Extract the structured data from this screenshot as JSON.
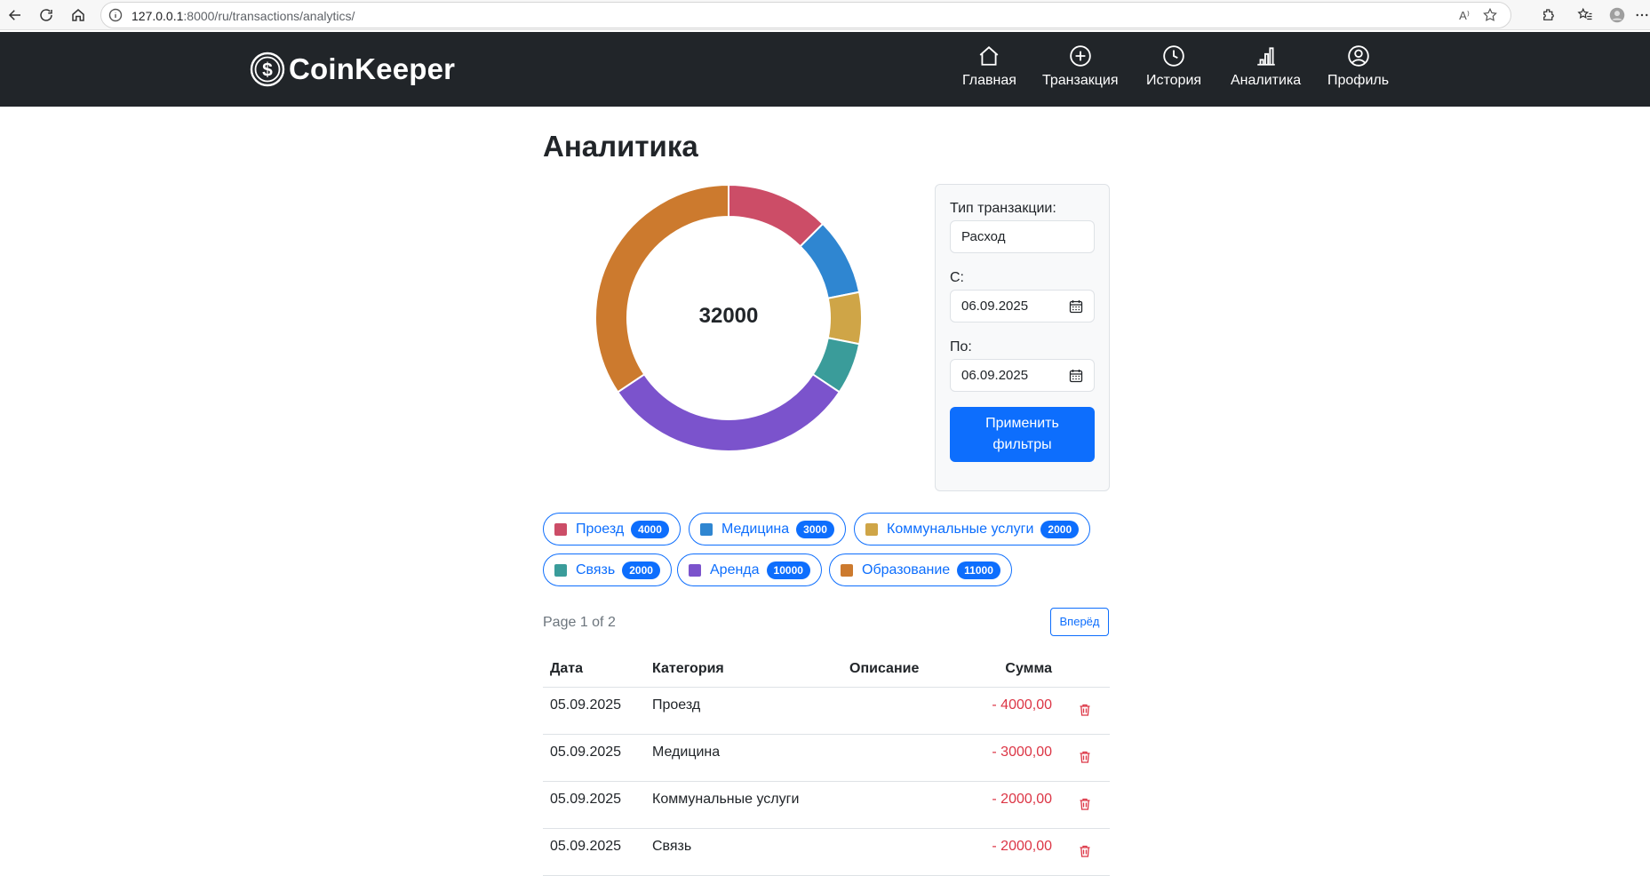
{
  "browser": {
    "url_host": "127.0.0.1",
    "url_rest": ":8000/ru/transactions/analytics/",
    "read_aloud": "A⁾"
  },
  "navbar": {
    "brand": "CoinKeeper",
    "items": [
      {
        "label": "Главная",
        "icon": "home-icon"
      },
      {
        "label": "Транзакция",
        "icon": "plus-circle-icon"
      },
      {
        "label": "История",
        "icon": "clock-icon"
      },
      {
        "label": "Аналитика",
        "icon": "bar-chart-icon"
      },
      {
        "label": "Профиль",
        "icon": "user-circle-icon"
      }
    ]
  },
  "page": {
    "title": "Аналитика",
    "total": "32000"
  },
  "chart_data": {
    "type": "pie",
    "categories": [
      "Проезд",
      "Медицина",
      "Коммунальные услуги",
      "Связь",
      "Аренда",
      "Образование"
    ],
    "values": [
      4000,
      3000,
      2000,
      2000,
      10000,
      11000
    ],
    "colors": [
      "#cc4d67",
      "#2f86d1",
      "#cfa547",
      "#3a9c9a",
      "#7b53cc",
      "#cc7a2e"
    ],
    "center_label": "32000"
  },
  "filters": {
    "type_label": "Тип транзакции:",
    "type_value": "Расход",
    "from_label": "С:",
    "from_value": "06.09.2025",
    "to_label": "По:",
    "to_value": "06.09.2025",
    "apply_line1": "Применить",
    "apply_line2": "фильтры"
  },
  "chips": [
    {
      "label": "Проезд",
      "count": "4000",
      "color": "#cc4d67"
    },
    {
      "label": "Медицина",
      "count": "3000",
      "color": "#2f86d1"
    },
    {
      "label": "Коммунальные услуги",
      "count": "2000",
      "color": "#cfa547"
    },
    {
      "label": "Связь",
      "count": "2000",
      "color": "#3a9c9a"
    },
    {
      "label": "Аренда",
      "count": "10000",
      "color": "#7b53cc"
    },
    {
      "label": "Образование",
      "count": "11000",
      "color": "#cc7a2e"
    }
  ],
  "pager": {
    "text": "Page 1 of 2",
    "next": "Вперёд"
  },
  "table": {
    "headers": [
      "Дата",
      "Категория",
      "Описание",
      "Сумма"
    ],
    "rows": [
      {
        "date": "05.09.2025",
        "category": "Проезд",
        "description": "",
        "amount": "- 4000,00"
      },
      {
        "date": "05.09.2025",
        "category": "Медицина",
        "description": "",
        "amount": "- 3000,00"
      },
      {
        "date": "05.09.2025",
        "category": "Коммунальные услуги",
        "description": "",
        "amount": "- 2000,00"
      },
      {
        "date": "05.09.2025",
        "category": "Связь",
        "description": "",
        "amount": "- 2000,00"
      }
    ]
  }
}
